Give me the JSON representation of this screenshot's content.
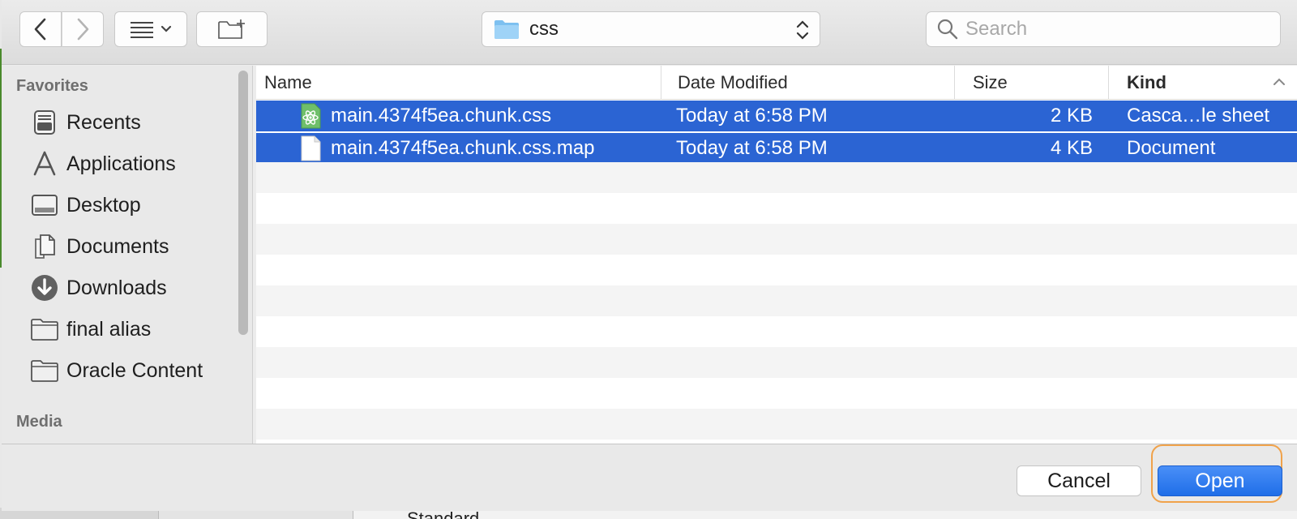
{
  "toolbar": {
    "back_icon": "chevron-left-icon",
    "forward_icon": "chevron-right-icon",
    "view_icon": "list-view-icon",
    "new_folder_icon": "new-folder-icon",
    "location": "css",
    "search_placeholder": "Search"
  },
  "sidebar": {
    "favorites_heading": "Favorites",
    "items": [
      {
        "label": "Recents",
        "icon": "recents-icon"
      },
      {
        "label": "Applications",
        "icon": "applications-icon"
      },
      {
        "label": "Desktop",
        "icon": "desktop-icon"
      },
      {
        "label": "Documents",
        "icon": "documents-icon"
      },
      {
        "label": "Downloads",
        "icon": "downloads-icon"
      },
      {
        "label": "final alias",
        "icon": "folder-icon"
      },
      {
        "label": "Oracle Content",
        "icon": "folder-icon"
      }
    ],
    "media_heading": "Media"
  },
  "columns": {
    "name": "Name",
    "date": "Date Modified",
    "size": "Size",
    "kind": "Kind"
  },
  "files": [
    {
      "name": "main.4374f5ea.chunk.css",
      "date": "Today at 6:58 PM",
      "size": "2 KB",
      "kind": "Casca…le sheet",
      "icon": "css-file-icon",
      "selected": true
    },
    {
      "name": "main.4374f5ea.chunk.css.map",
      "date": "Today at 6:58 PM",
      "size": "4 KB",
      "kind": "Document",
      "icon": "document-file-icon",
      "selected": true
    }
  ],
  "footer": {
    "cancel_label": "Cancel",
    "open_label": "Open"
  },
  "background": {
    "partial_text": "Standard"
  },
  "colors": {
    "selection": "#2b64d3",
    "focus_ring": "#f0a24a",
    "primary_button": "#1f6ee8"
  }
}
